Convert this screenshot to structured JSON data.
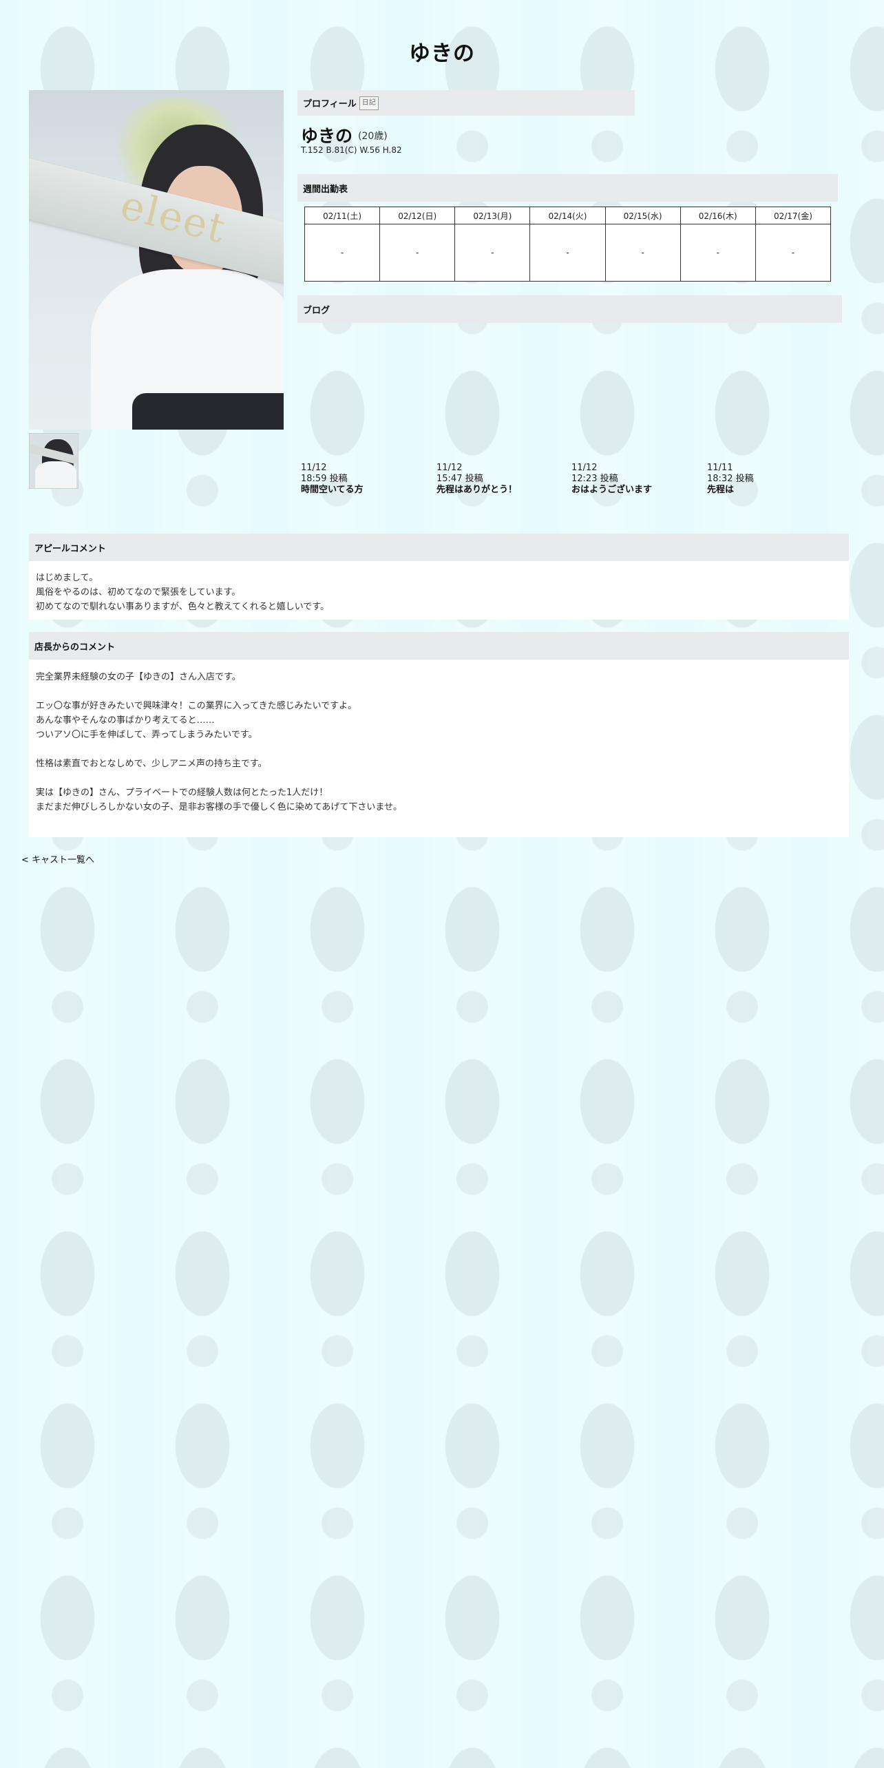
{
  "page": {
    "title": "ゆきの"
  },
  "profile": {
    "section_label": "プロフィール",
    "diary_label": "日記",
    "name": "ゆきの",
    "age": "(20歳)",
    "stats": "T.152 B.81(C) W.56 H.82",
    "photo_logo": "eleet"
  },
  "schedule": {
    "section_label": "週間出勤表",
    "days": [
      "02/11(土)",
      "02/12(日)",
      "02/13(月)",
      "02/14(火)",
      "02/15(水)",
      "02/16(木)",
      "02/17(金)"
    ],
    "values": [
      "-",
      "-",
      "-",
      "-",
      "-",
      "-",
      "-"
    ]
  },
  "blog": {
    "section_label": "ブログ",
    "posts": [
      {
        "date": "11/12",
        "time": "18:59 投稿",
        "title": "時間空いてる方"
      },
      {
        "date": "11/12",
        "time": "15:47 投稿",
        "title": "先程はありがとう！"
      },
      {
        "date": "11/12",
        "time": "12:23 投稿",
        "title": "おはようございます"
      },
      {
        "date": "11/11",
        "time": "18:32 投稿",
        "title": "先程は"
      }
    ]
  },
  "appeal": {
    "section_label": "アピールコメント",
    "lines": [
      "はじめまして。",
      "風俗をやるのは、初めてなので緊張をしています。",
      "初めてなので馴れない事ありますが、色々と教えてくれると嬉しいです。"
    ]
  },
  "manager": {
    "section_label": "店長からのコメント",
    "lines": [
      "完全業界未経験の女の子【ゆきの】さん入店です。",
      "",
      "エッ〇な事が好きみたいで興味津々！この業界に入ってきた感じみたいですよ。",
      "あんな事やそんなの事ばかり考えてると……",
      "ついアソ〇に手を伸ばして、弄ってしまうみたいです。",
      "",
      "性格は素直でおとなしめで、少しアニメ声の持ち主です。",
      "",
      "実は【ゆきの】さん、プライベートでの経験人数は何とたった1人だけ！",
      "まだまだ伸びしろしかない女の子、是非お客様の手で優しく色に染めてあげて下さいませ。"
    ]
  },
  "footer": {
    "back_link": "< キャスト一覧へ"
  }
}
